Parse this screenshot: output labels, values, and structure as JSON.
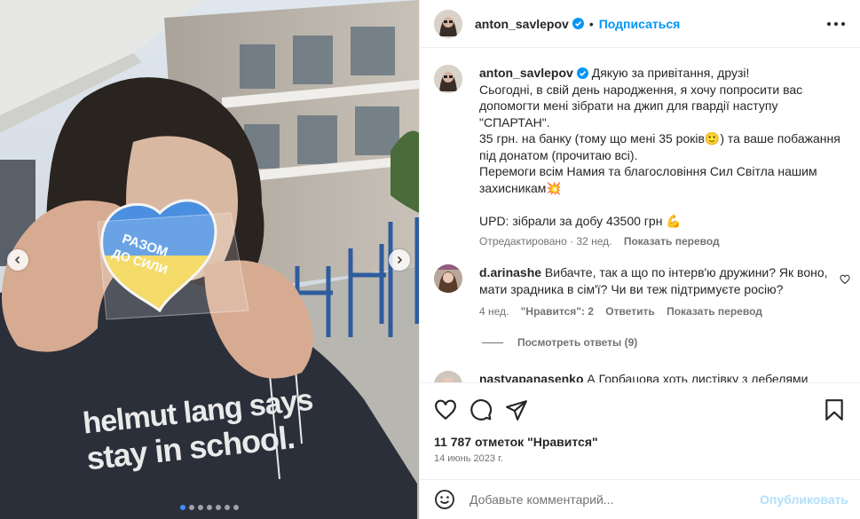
{
  "post": {
    "username": "anton_savlepov",
    "follow_label": "Подписаться",
    "separator": "•"
  },
  "media": {
    "slide_count": 7,
    "active_slide": 0,
    "sweatshirt_text_line1": "helmut lang says",
    "sweatshirt_text_line2": "stay in school.",
    "cookie_text_line1": "РАЗОМ",
    "cookie_text_line2": "ДО СИЛИ"
  },
  "caption": {
    "username": "anton_savlepov",
    "text": " Дякую за привітання, друзі!\nСьогодні, в свій день народження, я хочу попросити вас допомогти мені зібрати на джип для гвардії наступу \"СПАРТАН\".\n35 грн. на банку (тому що мені 35 років🙂) та ваше побажання під донатом (прочитаю всі).\nПеремоги всім Намия та благословіння Сил Світла нашим захисникам💥\n\nUPD: зібрали за добу 43500 грн 💪",
    "edited": "Отредактировано",
    "age": "32 нед.",
    "translate": "Показать перевод"
  },
  "comments": [
    {
      "username": "d.arinashe",
      "text": "Вибачте, так а що по інтерв'ю дружини? Як воно, мати зрадника в сім'ї? Чи ви теж підтримуєте росію?",
      "age": "4 нед.",
      "likes": "\"Нравится\": 2",
      "reply": "Ответить",
      "translate": "Показать перевод",
      "view_replies": "Посмотреть ответы (9)"
    },
    {
      "username": "nastyapanasenko",
      "text": "А Горбацова хоть листівку з лебелями"
    }
  ],
  "engagement": {
    "likes": "11 787 отметок \"Нравится\"",
    "date": "14 июнь 2023 г."
  },
  "add_comment": {
    "placeholder": "Добавьте комментарий...",
    "publish_label": "Опубликовать"
  },
  "colors": {
    "accent": "#0095f6",
    "verified": "#0095f6",
    "muted": "#737373",
    "publish_disabled": "#b2dffc"
  }
}
